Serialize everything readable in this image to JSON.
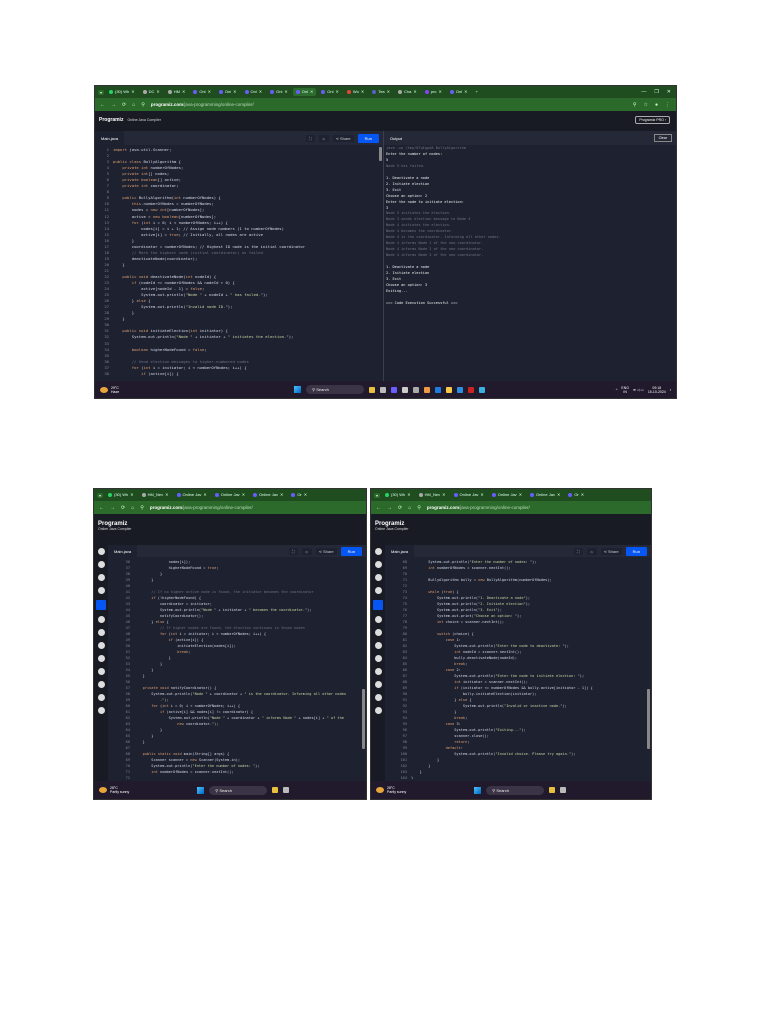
{
  "shots": [
    {
      "id": "top",
      "tabs": [
        {
          "label": "(30) Wh",
          "fav": "#25d366"
        },
        {
          "label": "DC",
          "fav": "#aaa"
        },
        {
          "label": "HM",
          "fav": "#aaa"
        },
        {
          "label": "Onl",
          "fav": "#6a5cff"
        },
        {
          "label": "Onl",
          "fav": "#6a5cff"
        },
        {
          "label": "Onl",
          "fav": "#6a5cff"
        },
        {
          "label": "Onl",
          "fav": "#6a5cff"
        },
        {
          "label": "Onl",
          "fav": "#6a5cff",
          "active": true
        },
        {
          "label": "Onl",
          "fav": "#6a5cff"
        },
        {
          "label": "Wo",
          "fav": "#ea4335"
        },
        {
          "label": "Tea",
          "fav": "#5b5fc7"
        },
        {
          "label": "Cha",
          "fav": "#aaa"
        },
        {
          "label": "pro",
          "fav": "#8b3dff"
        },
        {
          "label": "Onl",
          "fav": "#6a5cff"
        }
      ],
      "url_host": "programiz.com",
      "url_path": "/java-programming/online-compiler/",
      "site_title": "Programiz",
      "site_subtitle": "Online Java Compiler",
      "pro_button": "Programiz PRO ›",
      "file_tab": "Main.java",
      "share_label": "Share",
      "run_label": "Run",
      "output_label": "Output",
      "clear_label": "Clear",
      "weather_temp": "29°C",
      "weather_desc": "Haze",
      "search_label": "Search",
      "lang": "ENG",
      "region": "IN",
      "time": "09:18",
      "date": "15-10-2024",
      "code_start": 1,
      "code": [
        "import java.util.Scanner;",
        "",
        "public class BullyAlgorithm {",
        "    private int numberOfNodes;",
        "    private int[] nodes;",
        "    private boolean[] active;",
        "    private int coordinator;",
        "",
        "    public BullyAlgorithm(int numberOfNodes) {",
        "        this.numberOfNodes = numberOfNodes;",
        "        nodes = new int[numberOfNodes];",
        "        active = new boolean[numberOfNodes];",
        "        for (int i = 0; i < numberOfNodes; i++) {",
        "            nodes[i] = i + 1; // Assign node numbers (1 to numberOfNodes)",
        "            active[i] = true; // Initially, all nodes are active",
        "        }",
        "        coordinator = numberOfNodes; // Highest ID node is the initial coordinator",
        "        // Mark the highest node (initial coordinator) as failed",
        "        deactivateNode(coordinator);",
        "    }",
        "",
        "    public void deactivateNode(int nodeId) {",
        "        if (nodeId <= numberOfNodes && nodeId > 0) {",
        "            active[nodeId - 1] = false;",
        "            System.out.println(\"Node \" + nodeId + \" has failed.\");",
        "        } else {",
        "            System.out.println(\"Invalid node ID.\");",
        "        }",
        "    }",
        "",
        "    public void initiateElection(int initiator) {",
        "        System.out.println(\"Node \" + initiator + \" initiates the election.\");",
        "",
        "        boolean higherNodeFound = false;",
        "",
        "        // Send election messages to higher-numbered nodes",
        "        for (int i = initiator; i < numberOfNodes; i++) {",
        "            if (active[i]) {"
      ],
      "output": [
        {
          "text": "java -cp /tmp/8TqIgpdA BullyAlgorithm",
          "dim": true
        },
        {
          "text": "Enter the number of nodes:"
        },
        {
          "text": "5"
        },
        {
          "text": "Node 5 has failed.",
          "dim": true
        },
        {
          "text": ""
        },
        {
          "text": "1. Deactivate a node"
        },
        {
          "text": "2. Initiate election"
        },
        {
          "text": "3. Exit"
        },
        {
          "text": "Choose an option: 2"
        },
        {
          "text": "Enter the node to initiate election:"
        },
        {
          "text": "3"
        },
        {
          "text": "Node 3 initiates the election.",
          "dim": true
        },
        {
          "text": "Node 3 sends election message to Node 4",
          "dim": true
        },
        {
          "text": "Node 4 initiates the election.",
          "dim": true
        },
        {
          "text": "Node 4 becomes the coordinator.",
          "dim": true
        },
        {
          "text": "Node 4 is the coordinator. Informing all other nodes.",
          "dim": true
        },
        {
          "text": "Node 4 informs Node 1 of the new coordinator.",
          "dim": true
        },
        {
          "text": "Node 4 informs Node 2 of the new coordinator.",
          "dim": true
        },
        {
          "text": "Node 4 informs Node 3 of the new coordinator.",
          "dim": true
        },
        {
          "text": ""
        },
        {
          "text": "1. Deactivate a node"
        },
        {
          "text": "2. Initiate election"
        },
        {
          "text": "3. Exit"
        },
        {
          "text": "Choose an option: 3"
        },
        {
          "text": "Exiting..."
        },
        {
          "text": ""
        },
        {
          "text": "=== Code Execution Successful ==="
        }
      ]
    },
    {
      "id": "bottom-left",
      "tabs": [
        {
          "label": "(30) Wh",
          "fav": "#25d366"
        },
        {
          "label": "HM_Nev",
          "fav": "#aaa"
        },
        {
          "label": "Online Jav",
          "fav": "#6a5cff"
        },
        {
          "label": "Online Jav",
          "fav": "#6a5cff"
        },
        {
          "label": "Online Jav",
          "fav": "#6a5cff"
        },
        {
          "label": "Or",
          "fav": "#6a5cff"
        }
      ],
      "url_host": "programiz.com",
      "url_path": "/java-programming/online-compiler/",
      "site_title": "Programiz",
      "site_subtitle": "Online Java Compiler",
      "file_tab": "Main.java",
      "share_label": "Share",
      "run_label": "Run",
      "weather_temp": "28°C",
      "weather_desc": "Partly sunny",
      "search_label": "Search",
      "code_start": 36,
      "code": [
        "                nodes[i]);",
        "                higherNodeFound = true;",
        "            }",
        "        }",
        "",
        "        // If no higher active node is found, the initiator becomes the coordinator",
        "        if (!higherNodeFound) {",
        "            coordinator = initiator;",
        "            System.out.println(\"Node \" + initiator + \" becomes the coordinator.\");",
        "            notifyCoordinator();",
        "        } else {",
        "            // If higher nodes are found, the election continues in those nodes",
        "            for (int i = initiator; i < numberOfNodes; i++) {",
        "                if (active[i]) {",
        "                    initiateElection(nodes[i]);",
        "                    break;",
        "                }",
        "            }",
        "        }",
        "    }",
        "",
        "    private void notifyCoordinator() {",
        "        System.out.println(\"Node \" + coordinator + \" is the coordinator. Informing all other nodes",
        "            .\");",
        "        for (int i = 0; i < numberOfNodes; i++) {",
        "            if (active[i] && nodes[i] != coordinator) {",
        "                System.out.println(\"Node \" + coordinator + \" informs Node \" + nodes[i] + \" of the",
        "                    new coordinator.\");",
        "            }",
        "        }",
        "    }",
        "",
        "    public static void main(String[] args) {",
        "        Scanner scanner = new Scanner(System.in);",
        "        System.out.println(\"Enter the number of nodes: \");",
        "        int numberOfNodes = scanner.nextInt();",
        "",
        "        BullyAlgorithm bully = new BullyAlgorithm(numberOfNodes);"
      ]
    },
    {
      "id": "bottom-right",
      "tabs": [
        {
          "label": "(30) Wh",
          "fav": "#25d366"
        },
        {
          "label": "HM_Nev",
          "fav": "#aaa"
        },
        {
          "label": "Online Jav",
          "fav": "#6a5cff"
        },
        {
          "label": "Online Jav",
          "fav": "#6a5cff"
        },
        {
          "label": "Online Jav",
          "fav": "#6a5cff"
        },
        {
          "label": "Or",
          "fav": "#6a5cff"
        }
      ],
      "url_host": "programiz.com",
      "url_path": "/java-programming/online-compiler/",
      "site_title": "Programiz",
      "site_subtitle": "Online Java Compiler",
      "file_tab": "Main.java",
      "share_label": "Share",
      "run_label": "Run",
      "weather_temp": "28°C",
      "weather_desc": "Partly sunny",
      "search_label": "Search",
      "code_start": 68,
      "code": [
        "        System.out.println(\"Enter the number of nodes: \");",
        "        int numberOfNodes = scanner.nextInt();",
        "",
        "        BullyAlgorithm bully = new BullyAlgorithm(numberOfNodes);",
        "",
        "        while (true) {",
        "            System.out.println(\"1. Deactivate a node\");",
        "            System.out.println(\"2. Initiate election\");",
        "            System.out.println(\"3. Exit\");",
        "            System.out.print(\"Choose an option: \");",
        "            int choice = scanner.nextInt();",
        "",
        "            switch (choice) {",
        "                case 1:",
        "                    System.out.println(\"Enter the node to deactivate: \");",
        "                    int nodeId = scanner.nextInt();",
        "                    bully.deactivateNode(nodeId);",
        "                    break;",
        "                case 2:",
        "                    System.out.println(\"Enter the node to initiate election: \");",
        "                    int initiator = scanner.nextInt();",
        "                    if (initiator <= numberOfNodes && bully.active[initiator - 1]) {",
        "                        bully.initiateElection(initiator);",
        "                    } else {",
        "                        System.out.println(\"Invalid or inactive node.\");",
        "                    }",
        "                    break;",
        "                case 3:",
        "                    System.out.println(\"Exiting...\");",
        "                    scanner.close();",
        "                    return;",
        "                default:",
        "                    System.out.println(\"Invalid choice. Please try again.\");",
        "            }",
        "        }",
        "    }",
        "}",
        ""
      ]
    }
  ],
  "colors": {
    "chrome_green": "#1f4d1f",
    "editor_bg": "#1e2130",
    "run_blue": "#0556f3",
    "taskbar": "#201a2c"
  }
}
